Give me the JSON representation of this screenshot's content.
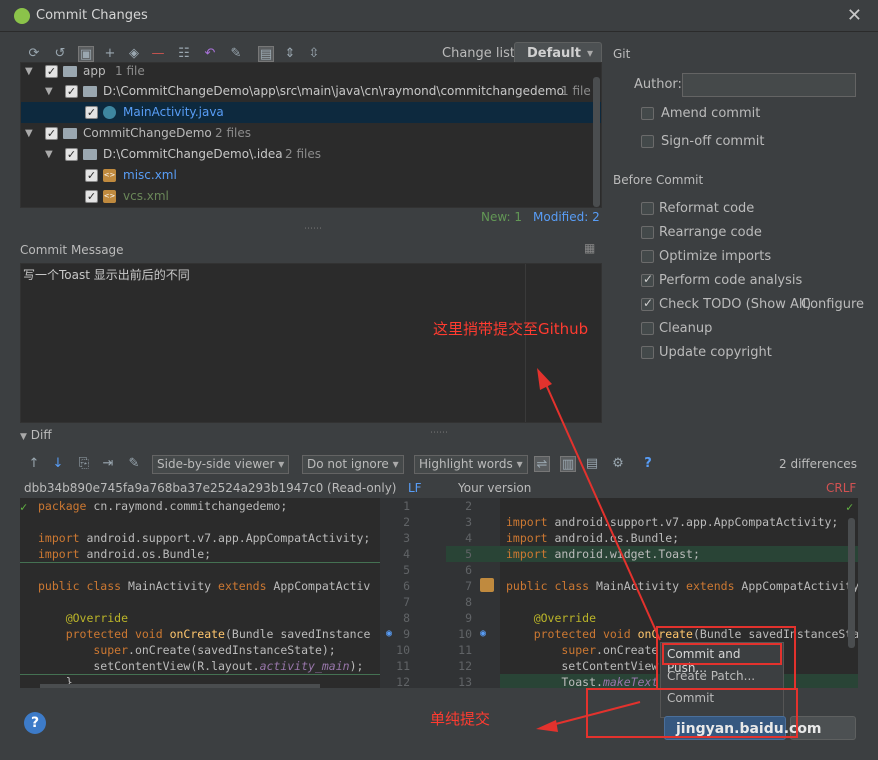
{
  "window": {
    "title": "Commit Changes",
    "close_glyph": "✕"
  },
  "toolbar": {
    "changelist_label": "Change list:",
    "changelist_value": "Default"
  },
  "tree": {
    "rows": [
      {
        "label": "app",
        "meta": "1 file"
      },
      {
        "label": "D:\\CommitChangeDemo\\app\\src\\main\\java\\cn\\raymond\\commitchangedemo",
        "meta": "1 file"
      },
      {
        "label": "MainActivity.java",
        "meta": ""
      },
      {
        "label": "CommitChangeDemo",
        "meta": "2 files"
      },
      {
        "label": "D:\\CommitChangeDemo\\.idea",
        "meta": "2 files"
      },
      {
        "label": "misc.xml",
        "meta": ""
      },
      {
        "label": "vcs.xml",
        "meta": ""
      }
    ],
    "status_new": "New: 1",
    "status_modified": "Modified: 2"
  },
  "commit_message": {
    "label": "Commit Message",
    "text": "写一个Toast 显示出前后的不同"
  },
  "git": {
    "section_label": "Git",
    "author_label": "Author:",
    "amend_label": "Amend commit",
    "signoff_label": "Sign-off commit"
  },
  "before_commit": {
    "section_label": "Before Commit",
    "options": [
      {
        "label": "Reformat code",
        "checked": false
      },
      {
        "label": "Rearrange code",
        "checked": false
      },
      {
        "label": "Optimize imports",
        "checked": false
      },
      {
        "label": "Perform code analysis",
        "checked": true
      },
      {
        "label": "Check TODO (Show All)",
        "checked": true
      },
      {
        "label": "Cleanup",
        "checked": false
      },
      {
        "label": "Update copyright",
        "checked": false
      }
    ],
    "configure_link": "Configure"
  },
  "diff": {
    "section_label": "Diff",
    "viewer": "Side-by-side viewer",
    "ignore": "Do not ignore",
    "highlight": "Highlight words",
    "differences": "2 differences",
    "left_title": "dbb34b890e745fa9a768ba37e2524a293b1947c0 (Read-only)",
    "left_eol": "LF",
    "right_title": "Your version",
    "right_eol": "CRLF",
    "left_lines": [
      "package cn.raymond.commitchangedemo;",
      "",
      "import android.support.v7.app.AppCompatActivity;",
      "import android.os.Bundle;",
      "",
      "public class MainActivity extends AppCompatActiv",
      "",
      "    @Override",
      "    protected void onCreate(Bundle savedInstance",
      "        super.onCreate(savedInstanceState);",
      "        setContentView(R.layout.activity_main);",
      "    }"
    ],
    "left_numbers": [
      "1",
      "2",
      "3",
      "4",
      "5",
      "6",
      "7",
      "8",
      "9",
      "10",
      "11",
      "12"
    ],
    "right_numbers": [
      "2",
      "3",
      "4",
      "5",
      "6",
      "7",
      "8",
      "9",
      "10",
      "11",
      "12",
      "13"
    ],
    "right_lines": [
      "",
      "import android.support.v7.app.AppCompatActivity;",
      "import android.os.Bundle;",
      "import android.widget.Toast;",
      "",
      "public class MainActivity extends AppCompatActivity",
      "",
      "    @Override",
      "    protected void onCreate(Bundle savedInstanceSta",
      "        super.onCreate",
      "        setContentView",
      "        Toast.makeText"
    ]
  },
  "popup": {
    "commit_and_push": "Commit and Push...",
    "create_patch": "Create Patch...",
    "commit": "Commit"
  },
  "annotations": {
    "top_note": "这里捎带提交至Github",
    "bottom_note": "单纯提交"
  },
  "watermark": "jingyan.baidu.com",
  "colors": {
    "accent": "#589df6",
    "annotation": "#e3322d",
    "selected_row": "#0d293e"
  },
  "icons": [
    "refresh-icon",
    "diff-icon",
    "add-icon",
    "remove-icon",
    "undo-icon",
    "edit-icon",
    "expand-icon",
    "collapse-icon",
    "settings-icon",
    "help-icon",
    "arrow-up-icon",
    "arrow-down-icon"
  ]
}
